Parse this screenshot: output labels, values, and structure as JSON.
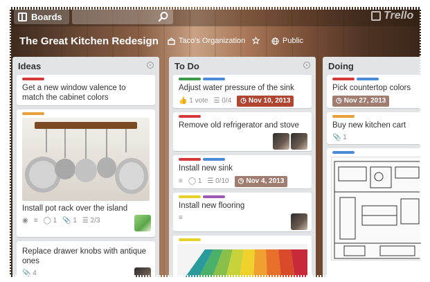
{
  "header": {
    "boards_label": "Boards",
    "logo_text": "Trello",
    "board_title": "The Great Kitchen Redesign",
    "organization": "Taco's Organization",
    "visibility": "Public"
  },
  "lists": {
    "ideas": {
      "title": "Ideas",
      "cards": [
        {
          "text": "Get a new window valence to match the cabinet colors"
        },
        {
          "text": "Install pot rack over the island",
          "badge_comments": "1",
          "badge_attachments": "1",
          "badge_checklist": "2/3"
        },
        {
          "text": "Replace drawer knobs with antique ones",
          "badge_attachments": "4"
        }
      ]
    },
    "todo": {
      "title": "To Do",
      "cards": [
        {
          "text": "Adjust water pressure of the sink",
          "badge_votes": "1 vote",
          "badge_checklist": "0/4",
          "badge_due": "Nov 10, 2013"
        },
        {
          "text": "Remove old refrigerator and stove"
        },
        {
          "text": "Install new sink",
          "badge_comments": "1",
          "badge_checklist": "0/10",
          "badge_due": "Nov 4, 2013"
        },
        {
          "text": "Install new flooring"
        }
      ]
    },
    "doing": {
      "title": "Doing",
      "cards": [
        {
          "text": "Pick countertop colors",
          "badge_due": "Nov 27, 2013"
        },
        {
          "text": "Buy new kitchen cart",
          "badge_attachments": "1"
        }
      ]
    }
  },
  "colors": {
    "label_red": "#d63a3a",
    "label_blue": "#4a8ad6",
    "label_green": "#3a9a4a",
    "label_orange": "#e8a03a",
    "label_yellow": "#e6d22a",
    "label_purple": "#9b59b6",
    "due_badge": "#b04632"
  }
}
